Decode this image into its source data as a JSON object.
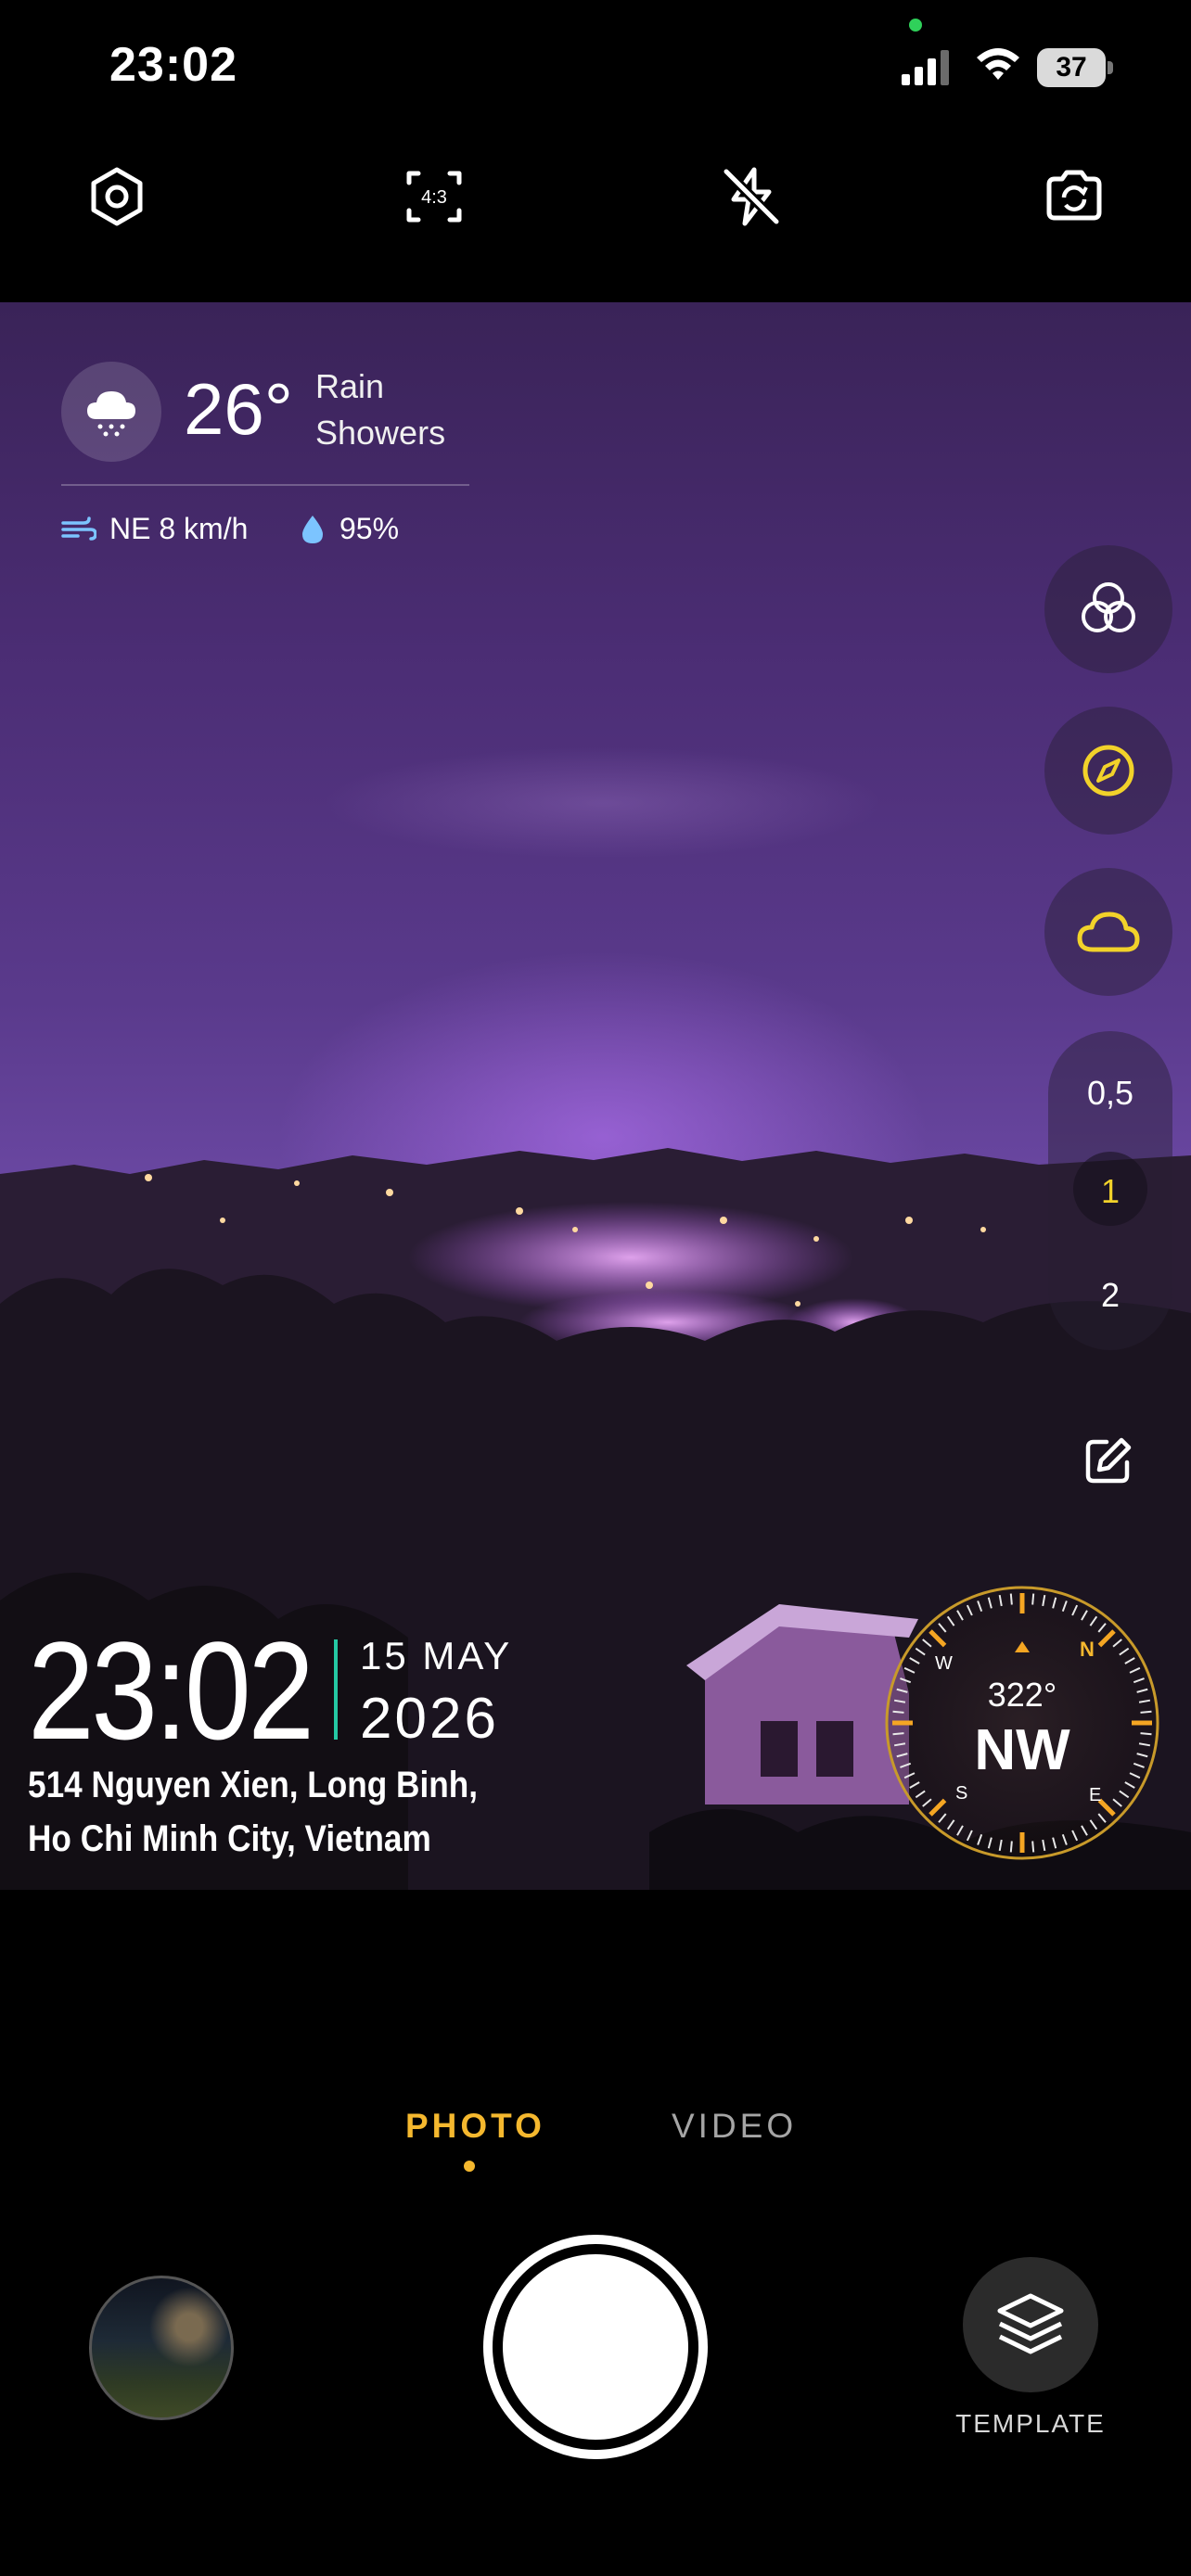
{
  "status_bar": {
    "time": "23:02",
    "battery_level": "37"
  },
  "weather": {
    "temperature": "26°",
    "condition": "Rain Showers",
    "wind": "NE 8 km/h",
    "humidity": "95%"
  },
  "zoom": {
    "options": [
      "0,5",
      "1",
      "2"
    ],
    "selected": "1"
  },
  "overlay": {
    "time": "23:02",
    "date_day_month": "15 MAY",
    "date_year": "2026",
    "address": "514 Nguyen Xien, Long Binh, Ho Chi Minh City, Vietnam"
  },
  "compass": {
    "degrees": "322°",
    "direction": "NW",
    "cardinal_n": "N",
    "cardinal_e": "E",
    "cardinal_s": "S",
    "cardinal_w": "W"
  },
  "modes": {
    "photo": "PHOTO",
    "video": "VIDEO",
    "active": "PHOTO"
  },
  "template_label": "TEMPLATE",
  "colors": {
    "accent": "#f5b82e",
    "yellow_icon": "#f2d22a",
    "teal_divider": "#25c8a4"
  },
  "icons": {
    "settings": "settings-hex-icon",
    "aspect": "aspect-ratio-icon",
    "flash_off": "flash-off-icon",
    "flip": "flip-camera-icon",
    "weather": "rain-cloud-icon",
    "wind": "wind-icon",
    "humidity": "water-drop-icon",
    "filters": "filters-circles-icon",
    "compass": "compass-icon",
    "cloud": "cloud-icon",
    "edit": "edit-icon",
    "template": "layers-icon"
  }
}
